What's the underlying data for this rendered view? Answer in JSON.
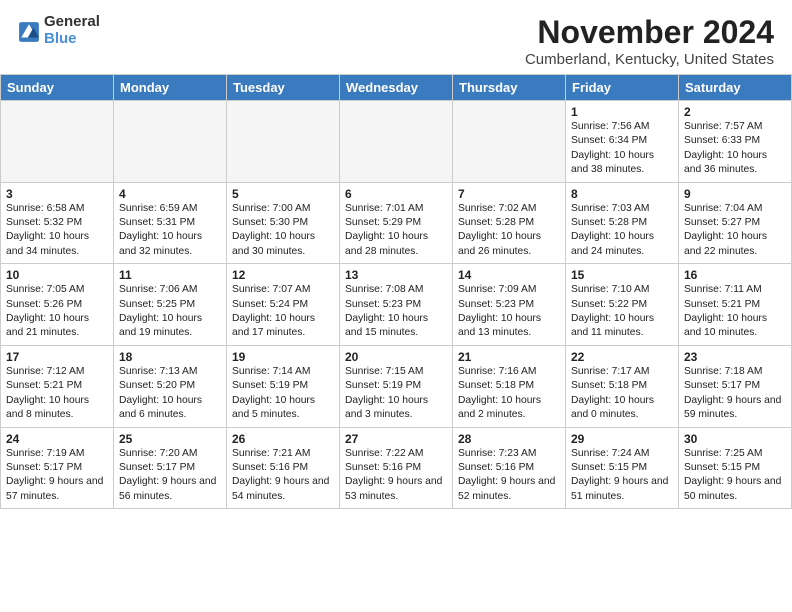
{
  "header": {
    "logo_line1": "General",
    "logo_line2": "Blue",
    "title": "November 2024",
    "subtitle": "Cumberland, Kentucky, United States"
  },
  "weekdays": [
    "Sunday",
    "Monday",
    "Tuesday",
    "Wednesday",
    "Thursday",
    "Friday",
    "Saturday"
  ],
  "weeks": [
    [
      {
        "day": "",
        "info": ""
      },
      {
        "day": "",
        "info": ""
      },
      {
        "day": "",
        "info": ""
      },
      {
        "day": "",
        "info": ""
      },
      {
        "day": "",
        "info": ""
      },
      {
        "day": "1",
        "info": "Sunrise: 7:56 AM\nSunset: 6:34 PM\nDaylight: 10 hours and 38 minutes."
      },
      {
        "day": "2",
        "info": "Sunrise: 7:57 AM\nSunset: 6:33 PM\nDaylight: 10 hours and 36 minutes."
      }
    ],
    [
      {
        "day": "3",
        "info": "Sunrise: 6:58 AM\nSunset: 5:32 PM\nDaylight: 10 hours and 34 minutes."
      },
      {
        "day": "4",
        "info": "Sunrise: 6:59 AM\nSunset: 5:31 PM\nDaylight: 10 hours and 32 minutes."
      },
      {
        "day": "5",
        "info": "Sunrise: 7:00 AM\nSunset: 5:30 PM\nDaylight: 10 hours and 30 minutes."
      },
      {
        "day": "6",
        "info": "Sunrise: 7:01 AM\nSunset: 5:29 PM\nDaylight: 10 hours and 28 minutes."
      },
      {
        "day": "7",
        "info": "Sunrise: 7:02 AM\nSunset: 5:28 PM\nDaylight: 10 hours and 26 minutes."
      },
      {
        "day": "8",
        "info": "Sunrise: 7:03 AM\nSunset: 5:28 PM\nDaylight: 10 hours and 24 minutes."
      },
      {
        "day": "9",
        "info": "Sunrise: 7:04 AM\nSunset: 5:27 PM\nDaylight: 10 hours and 22 minutes."
      }
    ],
    [
      {
        "day": "10",
        "info": "Sunrise: 7:05 AM\nSunset: 5:26 PM\nDaylight: 10 hours and 21 minutes."
      },
      {
        "day": "11",
        "info": "Sunrise: 7:06 AM\nSunset: 5:25 PM\nDaylight: 10 hours and 19 minutes."
      },
      {
        "day": "12",
        "info": "Sunrise: 7:07 AM\nSunset: 5:24 PM\nDaylight: 10 hours and 17 minutes."
      },
      {
        "day": "13",
        "info": "Sunrise: 7:08 AM\nSunset: 5:23 PM\nDaylight: 10 hours and 15 minutes."
      },
      {
        "day": "14",
        "info": "Sunrise: 7:09 AM\nSunset: 5:23 PM\nDaylight: 10 hours and 13 minutes."
      },
      {
        "day": "15",
        "info": "Sunrise: 7:10 AM\nSunset: 5:22 PM\nDaylight: 10 hours and 11 minutes."
      },
      {
        "day": "16",
        "info": "Sunrise: 7:11 AM\nSunset: 5:21 PM\nDaylight: 10 hours and 10 minutes."
      }
    ],
    [
      {
        "day": "17",
        "info": "Sunrise: 7:12 AM\nSunset: 5:21 PM\nDaylight: 10 hours and 8 minutes."
      },
      {
        "day": "18",
        "info": "Sunrise: 7:13 AM\nSunset: 5:20 PM\nDaylight: 10 hours and 6 minutes."
      },
      {
        "day": "19",
        "info": "Sunrise: 7:14 AM\nSunset: 5:19 PM\nDaylight: 10 hours and 5 minutes."
      },
      {
        "day": "20",
        "info": "Sunrise: 7:15 AM\nSunset: 5:19 PM\nDaylight: 10 hours and 3 minutes."
      },
      {
        "day": "21",
        "info": "Sunrise: 7:16 AM\nSunset: 5:18 PM\nDaylight: 10 hours and 2 minutes."
      },
      {
        "day": "22",
        "info": "Sunrise: 7:17 AM\nSunset: 5:18 PM\nDaylight: 10 hours and 0 minutes."
      },
      {
        "day": "23",
        "info": "Sunrise: 7:18 AM\nSunset: 5:17 PM\nDaylight: 9 hours and 59 minutes."
      }
    ],
    [
      {
        "day": "24",
        "info": "Sunrise: 7:19 AM\nSunset: 5:17 PM\nDaylight: 9 hours and 57 minutes."
      },
      {
        "day": "25",
        "info": "Sunrise: 7:20 AM\nSunset: 5:17 PM\nDaylight: 9 hours and 56 minutes."
      },
      {
        "day": "26",
        "info": "Sunrise: 7:21 AM\nSunset: 5:16 PM\nDaylight: 9 hours and 54 minutes."
      },
      {
        "day": "27",
        "info": "Sunrise: 7:22 AM\nSunset: 5:16 PM\nDaylight: 9 hours and 53 minutes."
      },
      {
        "day": "28",
        "info": "Sunrise: 7:23 AM\nSunset: 5:16 PM\nDaylight: 9 hours and 52 minutes."
      },
      {
        "day": "29",
        "info": "Sunrise: 7:24 AM\nSunset: 5:15 PM\nDaylight: 9 hours and 51 minutes."
      },
      {
        "day": "30",
        "info": "Sunrise: 7:25 AM\nSunset: 5:15 PM\nDaylight: 9 hours and 50 minutes."
      }
    ]
  ]
}
